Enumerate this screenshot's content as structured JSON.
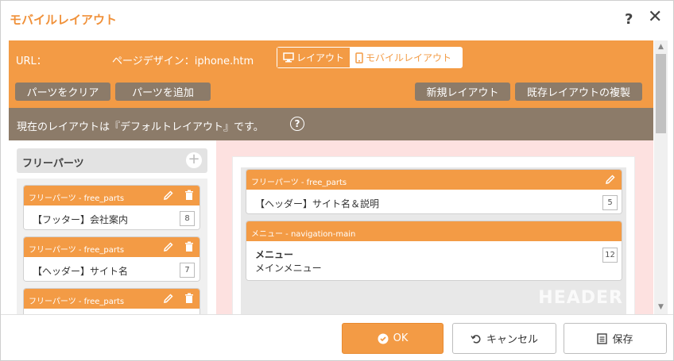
{
  "dialog": {
    "title": "モバイルレイアウト",
    "help": "?",
    "close": "✕"
  },
  "urlbar": {
    "url_label": "URL：",
    "page_design": "ページデザイン：iphone.htm",
    "toggle_layout": "レイアウト",
    "toggle_mobile": "モバイルレイアウト"
  },
  "toolbar": {
    "clear": "パーツをクリア",
    "add": "パーツを追加",
    "new_layout": "新規レイアウト",
    "copy_layout": "既存レイアウトの複製"
  },
  "info": {
    "text": "現在のレイアウトは『デフォルトレイアウト』です。",
    "help": "?"
  },
  "left_panel": {
    "title": "フリーパーツ",
    "add": "+",
    "parts": [
      {
        "head": "フリーパーツ - free_parts",
        "body": "【フッター】会社案内",
        "count": "8"
      },
      {
        "head": "フリーパーツ - free_parts",
        "body": "【ヘッダー】サイト名",
        "count": "7"
      },
      {
        "head": "フリーパーツ - free_parts",
        "body": "",
        "count": ""
      }
    ]
  },
  "canvas": {
    "zone_label": "HEADER",
    "parts": [
      {
        "head": "フリーパーツ - free_parts",
        "body": "【ヘッダー】サイト名＆説明",
        "count": "5"
      },
      {
        "head": "メニュー - navigation-main",
        "body1": "メニュー",
        "body2": "メインメニュー",
        "count": "12"
      }
    ]
  },
  "footer": {
    "ok": "OK",
    "cancel": "キャンセル",
    "save": "保存"
  },
  "colors": {
    "accent": "#f39b45",
    "brown": "#8c7b69",
    "pink": "#fde1e0",
    "title": "#f0913a"
  },
  "icons": [
    "desktop-icon",
    "mobile-icon",
    "question-circle-icon",
    "plus-circle-icon",
    "pencil-icon",
    "trash-icon",
    "check-circle-icon",
    "undo-icon",
    "save-document-icon"
  ]
}
